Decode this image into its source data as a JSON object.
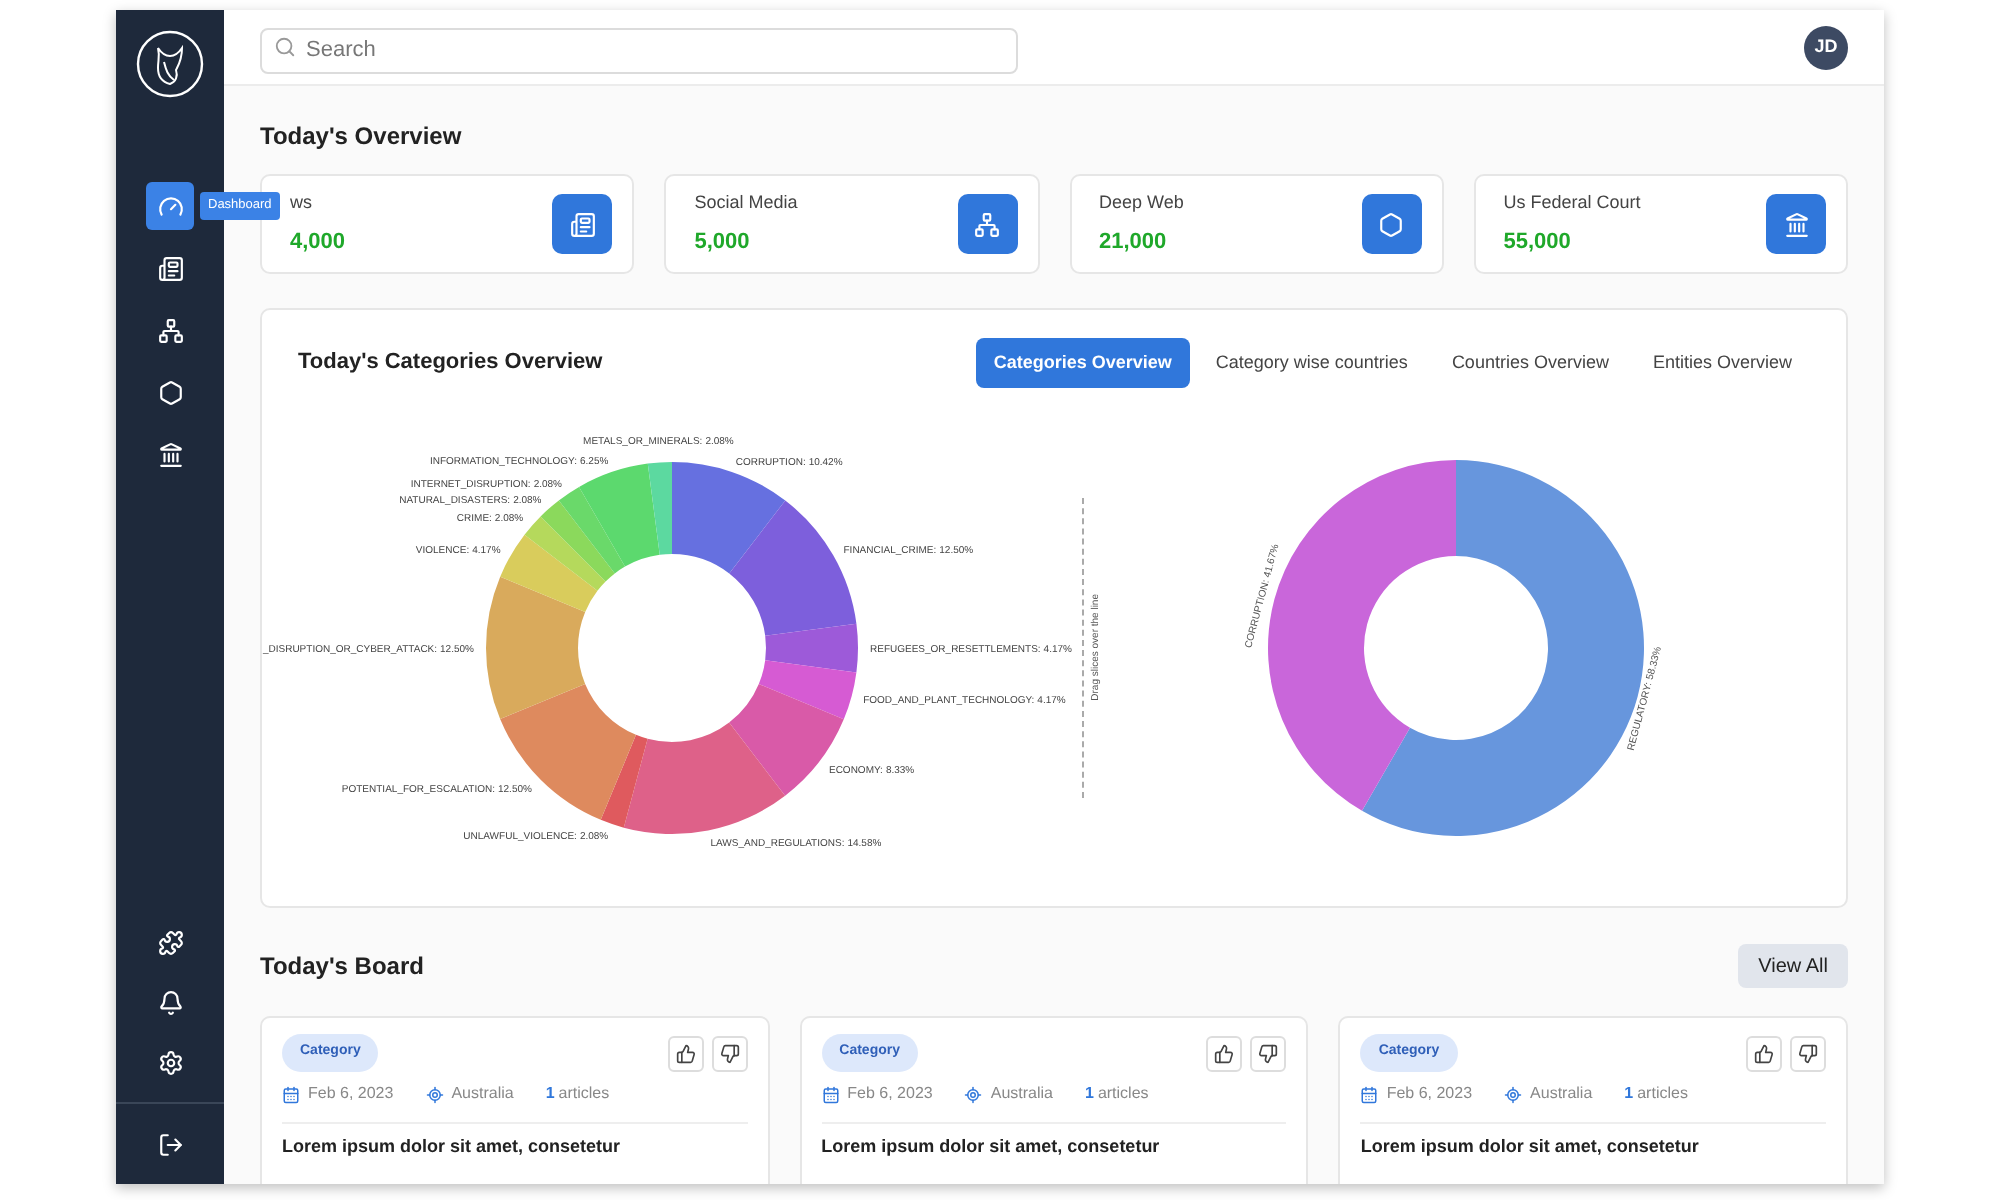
{
  "sidebar": {
    "items": [
      {
        "selected": true,
        "tooltip": "Dashboard"
      },
      {
        "selected": false
      },
      {
        "selected": false
      },
      {
        "selected": false
      },
      {
        "selected": false
      }
    ],
    "bottom_items": [
      {
        "selected": false
      },
      {
        "selected": false
      },
      {
        "selected": false
      }
    ]
  },
  "search": {
    "placeholder": "Search"
  },
  "user": {
    "initials": "JD"
  },
  "overview": {
    "title": "Today's Overview",
    "cards": [
      {
        "label": "ws",
        "value": "4,000"
      },
      {
        "label": "Social Media",
        "value": "5,000"
      },
      {
        "label": "Deep Web",
        "value": "21,000"
      },
      {
        "label": "Us Federal Court",
        "value": "55,000"
      }
    ]
  },
  "categories": {
    "title": "Today's Categories Overview",
    "tabs": [
      {
        "label": "Categories Overview",
        "selected": true
      },
      {
        "label": "Category wise countries",
        "selected": false
      },
      {
        "label": "Countries Overview",
        "selected": false
      },
      {
        "label": "Entities Overview",
        "selected": false
      }
    ],
    "drag_hint": "Drag slices over the line",
    "charts": [
      {
        "label_separator": ":",
        "chart_data": {
          "type": "donut",
          "categories": [
            "CORRUPTION",
            "FINANCIAL_CRIME",
            "REFUGEES_OR_RESETTLEMENTS",
            "FOOD_AND_PLANT_TECHNOLOGY",
            "ECONOMY",
            "LAWS_AND_REGULATIONS",
            "UNLAWFUL_VIOLENCE",
            "POTENTIAL_FOR_ESCALATION",
            "_DISRUPTION_OR_CYBER_ATTACK",
            "VIOLENCE",
            "CRIME",
            "NATURAL_DISASTERS",
            "INTERNET_DISRUPTION",
            "INFORMATION_TECHNOLOGY",
            "METALS_OR_MINERALS"
          ],
          "series": [
            {
              "values": [
                10.42,
                12.5,
                4.17,
                4.17,
                8.33,
                14.58,
                2.08,
                12.5,
                12.5,
                4.17,
                2.08,
                2.08,
                2.08,
                6.25,
                2.08
              ]
            }
          ],
          "value_labels": [
            "10.42%",
            "12.50%",
            "4.17%",
            "4.17%",
            "8.33%",
            "14.58%",
            "2.08%",
            "12.50%",
            "12.50%",
            "4.17%",
            "2.08%",
            "2.08%",
            "2.08%",
            "6.25%",
            "2.08%"
          ]
        }
      },
      {
        "label_separator": ":",
        "chart_data": {
          "type": "donut",
          "categories": [
            "REGULATORY",
            "CORRUPTION"
          ],
          "series": [
            {
              "values": [
                58.33,
                41.67
              ]
            }
          ],
          "value_labels": [
            "58.33%",
            "41.67%"
          ]
        }
      }
    ]
  },
  "board": {
    "title": "Today's Board",
    "view_all": "View All",
    "cards": [
      {
        "tag": "Category",
        "date": "Feb 6, 2023",
        "location": "Australia",
        "count": "1",
        "count_label": "articles",
        "title": "Lorem ipsum dolor sit amet, consetetur"
      },
      {
        "tag": "Category",
        "date": "Feb 6, 2023",
        "location": "Australia",
        "count": "1",
        "count_label": "articles",
        "title": "Lorem ipsum dolor sit amet, consetetur"
      },
      {
        "tag": "Category",
        "date": "Feb 6, 2023",
        "location": "Australia",
        "count": "1",
        "count_label": "articles",
        "title": "Lorem ipsum dolor sit amet, consetetur"
      }
    ]
  }
}
